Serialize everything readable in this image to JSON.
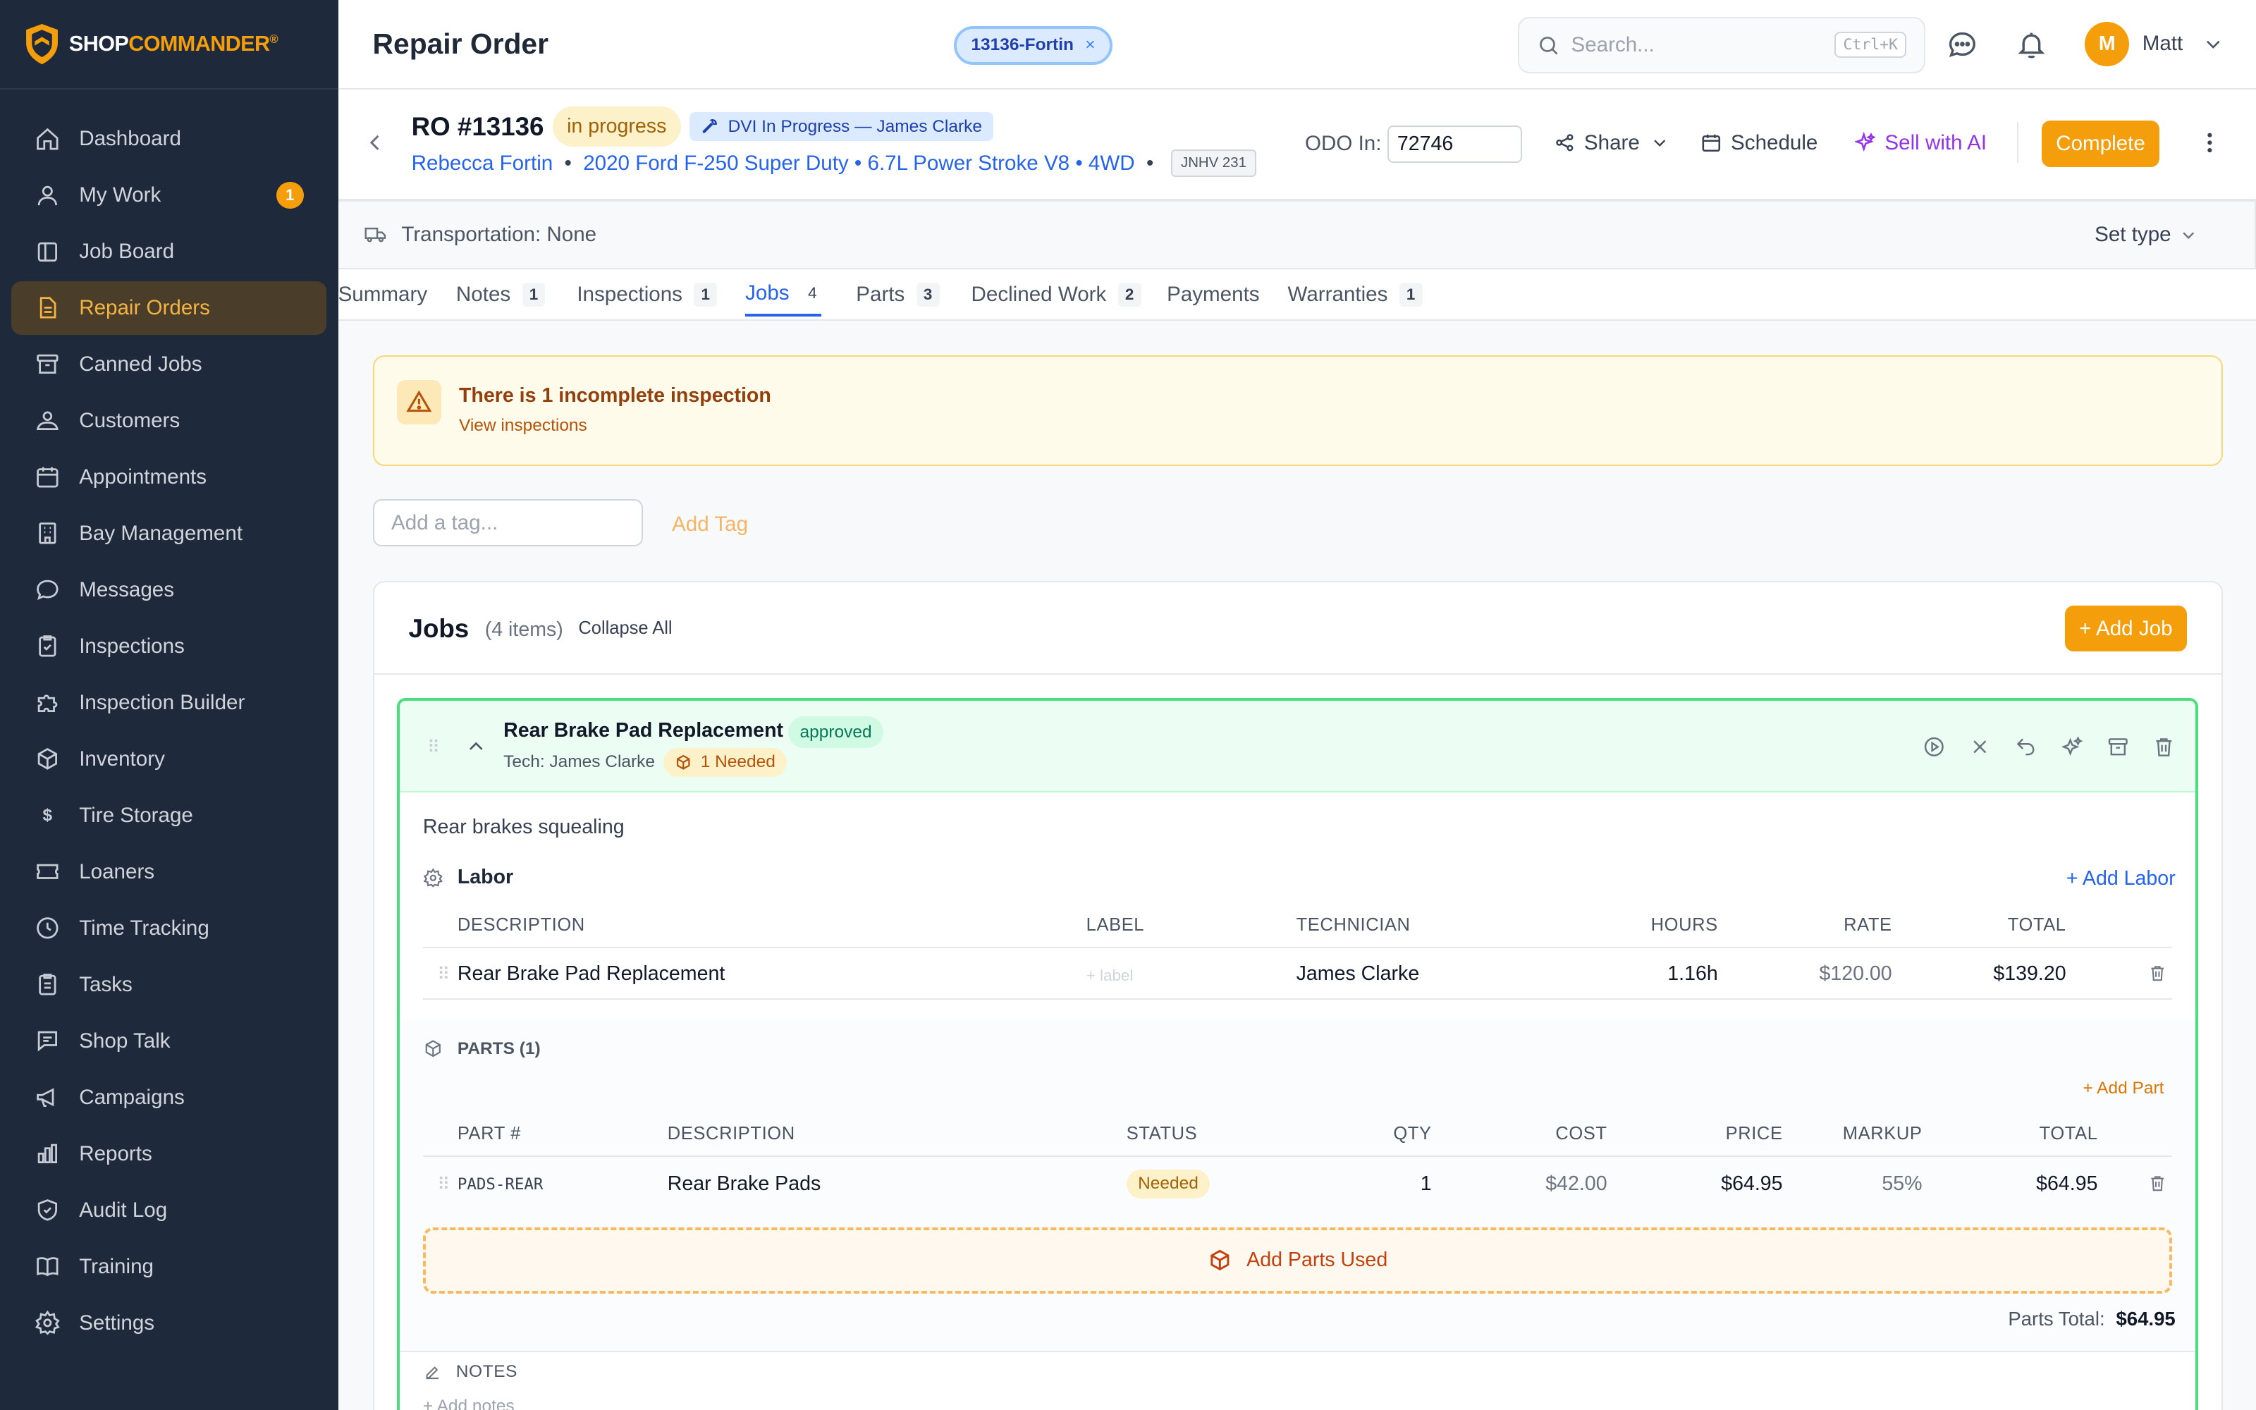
{
  "brand": {
    "shop": "SHOP",
    "commander": "COMMANDER",
    "reg": "®"
  },
  "colors": {
    "accent": "#f59e0b",
    "sidebar_bg": "#1e2a3b",
    "link": "#2563eb",
    "approved_border": "#4ade80"
  },
  "sidebar": {
    "items": [
      {
        "label": "Dashboard",
        "icon": "home-icon"
      },
      {
        "label": "My Work",
        "icon": "user-icon",
        "badge": "1"
      },
      {
        "label": "Job Board",
        "icon": "board-icon"
      },
      {
        "label": "Repair Orders",
        "icon": "document-icon",
        "active": true
      },
      {
        "label": "Canned Jobs",
        "icon": "archive-icon"
      },
      {
        "label": "Customers",
        "icon": "users-icon"
      },
      {
        "label": "Appointments",
        "icon": "calendar-icon"
      },
      {
        "label": "Bay Management",
        "icon": "building-icon"
      },
      {
        "label": "Messages",
        "icon": "chat-icon"
      },
      {
        "label": "Inspections",
        "icon": "clipboard-check-icon"
      },
      {
        "label": "Inspection Builder",
        "icon": "puzzle-icon"
      },
      {
        "label": "Inventory",
        "icon": "cube-icon"
      },
      {
        "label": "Tire Storage",
        "icon": "dollar-icon"
      },
      {
        "label": "Loaners",
        "icon": "ticket-icon"
      },
      {
        "label": "Time Tracking",
        "icon": "clock-icon"
      },
      {
        "label": "Tasks",
        "icon": "clipboard-list-icon"
      },
      {
        "label": "Shop Talk",
        "icon": "message-square-icon"
      },
      {
        "label": "Campaigns",
        "icon": "megaphone-icon"
      },
      {
        "label": "Reports",
        "icon": "bar-chart-icon"
      },
      {
        "label": "Audit Log",
        "icon": "shield-icon"
      },
      {
        "label": "Training",
        "icon": "book-icon"
      },
      {
        "label": "Settings",
        "icon": "gear-icon"
      }
    ]
  },
  "topbar": {
    "title": "Repair Order",
    "ro_chip": "13136-Fortin",
    "search_placeholder": "Search...",
    "search_shortcut": "Ctrl+K",
    "user_initial": "M",
    "user_name": "Matt"
  },
  "ro": {
    "number": "RO #13136",
    "status": "in progress",
    "dvi": "DVI In Progress — James Clarke",
    "customer": "Rebecca Fortin",
    "vehicle": "2020 Ford F-250 Super Duty • 6.7L Power Stroke V8 • 4WD",
    "plate": "JNHV 231",
    "odo_label": "ODO In:",
    "odo_value": "72746",
    "share": "Share",
    "schedule": "Schedule",
    "sell_ai": "Sell with AI",
    "complete": "Complete"
  },
  "transport": {
    "label": "Transportation: None",
    "set_type": "Set type"
  },
  "tabs": [
    {
      "label": "Summary"
    },
    {
      "label": "Notes",
      "count": "1"
    },
    {
      "label": "Inspections",
      "count": "1"
    },
    {
      "label": "Jobs",
      "count": "4",
      "active": true
    },
    {
      "label": "Parts",
      "count": "3"
    },
    {
      "label": "Declined Work",
      "count": "2"
    },
    {
      "label": "Payments"
    },
    {
      "label": "Warranties",
      "count": "1"
    }
  ],
  "alert": {
    "title": "There is 1 incomplete inspection",
    "link": "View inspections"
  },
  "tags": {
    "placeholder": "Add a tag...",
    "add": "Add Tag"
  },
  "jobs": {
    "title": "Jobs",
    "count": "(4 items)",
    "collapse_all": "Collapse All",
    "add_job": "+ Add Job",
    "job": {
      "name": "Rear Brake Pad Replacement",
      "status": "approved",
      "tech": "Tech: James Clarke",
      "parts_needed": "1 Needed",
      "concern": "Rear brakes squealing",
      "labor": {
        "title": "Labor",
        "add": "+ Add Labor",
        "headers": {
          "description": "DESCRIPTION",
          "label": "LABEL",
          "technician": "TECHNICIAN",
          "hours": "HOURS",
          "rate": "RATE",
          "total": "TOTAL"
        },
        "rows": [
          {
            "description": "Rear Brake Pad Replacement",
            "label": "+ label",
            "technician": "James Clarke",
            "hours": "1.16h",
            "rate": "$120.00",
            "total": "$139.20"
          }
        ]
      },
      "parts": {
        "title": "PARTS (1)",
        "add": "+ Add Part",
        "headers": {
          "part": "PART #",
          "description": "DESCRIPTION",
          "status": "STATUS",
          "qty": "QTY",
          "cost": "COST",
          "price": "PRICE",
          "markup": "MARKUP",
          "total": "TOTAL"
        },
        "rows": [
          {
            "part": "PADS-REAR",
            "description": "Rear Brake Pads",
            "status": "Needed",
            "qty": "1",
            "cost": "$42.00",
            "price": "$64.95",
            "markup": "55%",
            "total": "$64.95"
          }
        ],
        "add_used": "Add Parts Used",
        "total_label": "Parts Total:",
        "total_value": "$64.95"
      },
      "notes": {
        "title": "NOTES",
        "add": "+ Add notes"
      }
    }
  }
}
